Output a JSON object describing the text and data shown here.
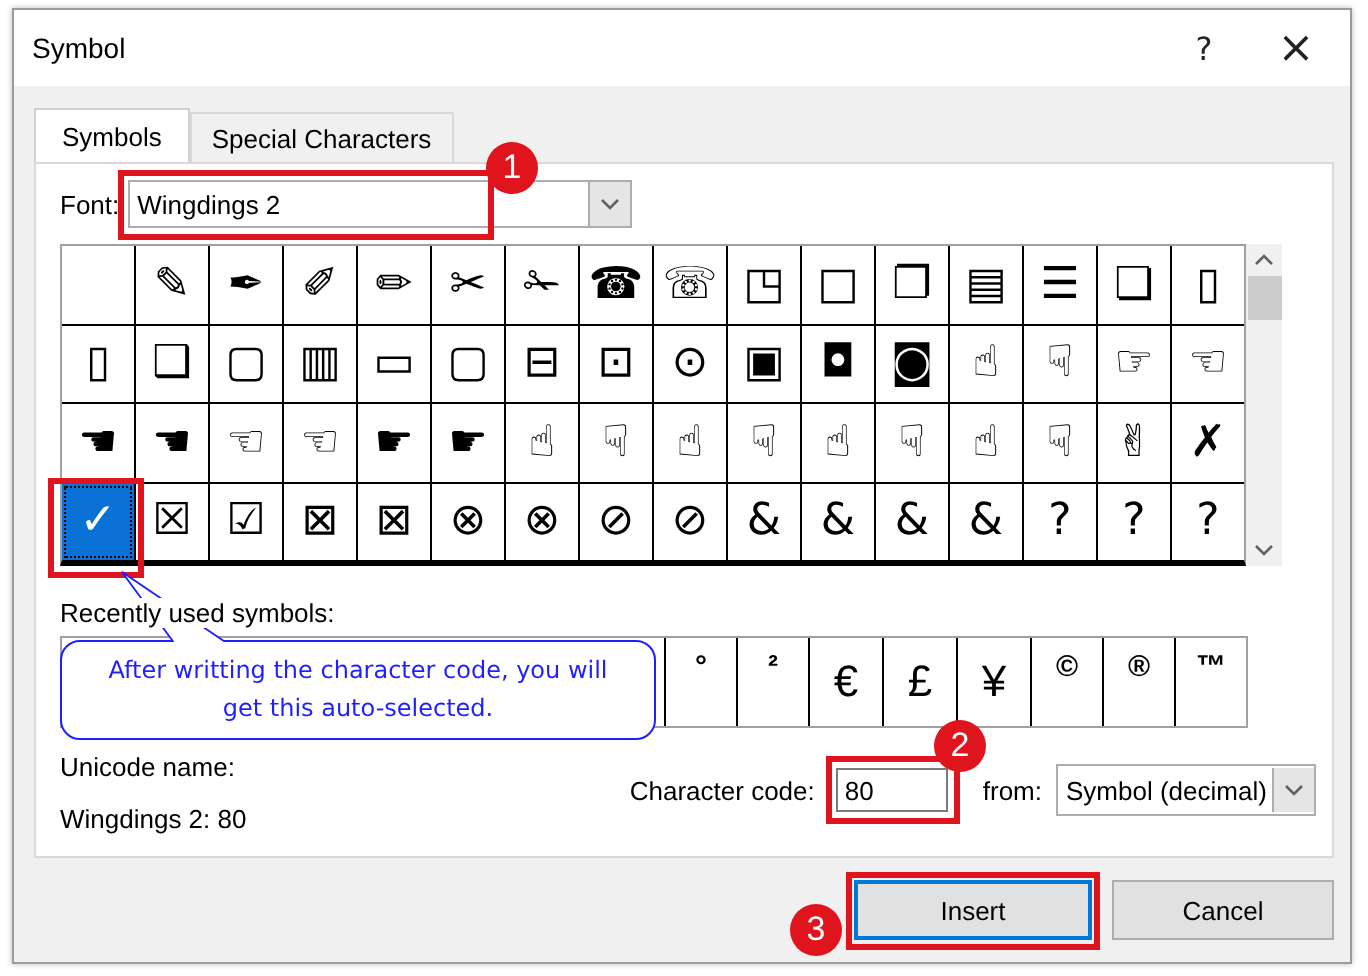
{
  "window": {
    "title": "Symbol",
    "help": "?",
    "close": "×"
  },
  "tabs": [
    {
      "label": "Symbols",
      "selected": true
    },
    {
      "label": "Special Characters",
      "selected": false
    }
  ],
  "font": {
    "label": "Font:",
    "value": "Wingdings 2"
  },
  "grid": [
    [
      {
        "selected": false
      },
      {
        "glyph": "✎",
        "selected": false
      },
      {
        "glyph": "✒",
        "selected": false
      },
      {
        "glyph": "✐",
        "selected": false
      },
      {
        "glyph": "✏",
        "selected": false
      },
      {
        "glyph": "✂",
        "selected": false
      },
      {
        "glyph": "✁",
        "selected": false
      },
      {
        "glyph": "☎",
        "selected": false
      },
      {
        "glyph": "☏",
        "selected": false
      },
      {
        "glyph": "◳",
        "selected": false
      },
      {
        "glyph": "□",
        "selected": false
      },
      {
        "glyph": "❐",
        "selected": false
      },
      {
        "glyph": "▤",
        "selected": false
      },
      {
        "glyph": "☰",
        "selected": false
      },
      {
        "glyph": "❏",
        "selected": false
      },
      {
        "glyph": "▯",
        "selected": false
      }
    ],
    [
      {
        "glyph": "▯",
        "selected": false
      },
      {
        "glyph": "❑",
        "selected": false
      },
      {
        "glyph": "▢",
        "selected": false
      },
      {
        "glyph": "▥",
        "selected": false
      },
      {
        "glyph": "▭",
        "selected": false
      },
      {
        "glyph": "▢",
        "selected": false
      },
      {
        "glyph": "⊟",
        "selected": false
      },
      {
        "glyph": "⊡",
        "selected": false
      },
      {
        "glyph": "⊙",
        "selected": false
      },
      {
        "glyph": "▣",
        "selected": false
      },
      {
        "glyph": "◘",
        "selected": false
      },
      {
        "glyph": "◙",
        "selected": false
      },
      {
        "glyph": "☝",
        "selected": false
      },
      {
        "glyph": "☟",
        "selected": false
      },
      {
        "glyph": "☞",
        "selected": false
      },
      {
        "glyph": "☜",
        "selected": false
      }
    ],
    [
      {
        "glyph": "☚",
        "selected": false
      },
      {
        "glyph": "☚",
        "selected": false
      },
      {
        "glyph": "☜",
        "selected": false
      },
      {
        "glyph": "☜",
        "selected": false
      },
      {
        "glyph": "☛",
        "selected": false
      },
      {
        "glyph": "☛",
        "selected": false
      },
      {
        "glyph": "☝",
        "selected": false
      },
      {
        "glyph": "☟",
        "selected": false
      },
      {
        "glyph": "☝",
        "selected": false
      },
      {
        "glyph": "☟",
        "selected": false
      },
      {
        "glyph": "☝",
        "selected": false
      },
      {
        "glyph": "☟",
        "selected": false
      },
      {
        "glyph": "☝",
        "selected": false
      },
      {
        "glyph": "☟",
        "selected": false
      },
      {
        "glyph": "✌",
        "selected": false
      },
      {
        "glyph": "✗",
        "selected": false
      }
    ],
    [
      {
        "glyph": "✓",
        "selected": true
      },
      {
        "glyph": "☒",
        "selected": false
      },
      {
        "glyph": "☑",
        "selected": false
      },
      {
        "glyph": "⊠",
        "selected": false
      },
      {
        "glyph": "⊠",
        "selected": false
      },
      {
        "glyph": "⊗",
        "selected": false
      },
      {
        "glyph": "⊗",
        "selected": false
      },
      {
        "glyph": "⊘",
        "selected": false
      },
      {
        "glyph": "⊘",
        "selected": false
      },
      {
        "glyph": "&",
        "selected": false
      },
      {
        "glyph": "&",
        "selected": false
      },
      {
        "glyph": "&",
        "selected": false
      },
      {
        "glyph": "&",
        "selected": false
      },
      {
        "glyph": "?",
        "selected": false
      },
      {
        "glyph": "?",
        "selected": false
      },
      {
        "glyph": "?",
        "selected": false
      }
    ]
  ],
  "recent": {
    "label": "Recently used symbols:",
    "visible_symbols": [
      "°",
      "²",
      "€",
      "£",
      "¥",
      "©",
      "®",
      "™"
    ]
  },
  "unicode_name": {
    "label": "Unicode name:",
    "value": "Wingdings 2: 80"
  },
  "character_code": {
    "label": "Character code:",
    "value": "80"
  },
  "from": {
    "label": "from:",
    "value": "Symbol (decimal)"
  },
  "buttons": [
    {
      "label": "Insert",
      "default": true
    },
    {
      "label": "Cancel",
      "default": false
    }
  ],
  "annotations": {
    "callout": "After writting the character code, you will get this auto-selected.",
    "steps": [
      "1",
      "2",
      "3"
    ]
  }
}
